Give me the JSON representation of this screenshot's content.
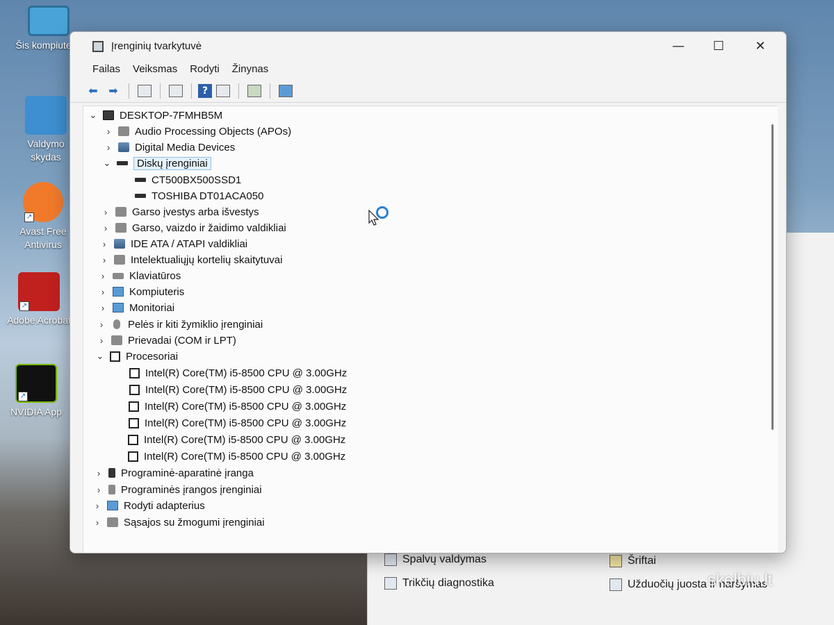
{
  "desktop_icons": [
    {
      "label": "Šis kompiuteris",
      "color": "#4aa3d8"
    },
    {
      "label": "Valdymo skydas",
      "color": "#3d8fd1"
    },
    {
      "label": "Avast Free Antivirus",
      "color": "#f07a2a"
    },
    {
      "label": "Adobe Acrobat",
      "color": "#c0201e"
    },
    {
      "label": "NVIDIA App",
      "color": "#76b900"
    }
  ],
  "window": {
    "title": "Įrenginių tvarkytuvė",
    "minimize": "—",
    "maximize": "☐",
    "close": "✕"
  },
  "menu": [
    "Failas",
    "Veiksmas",
    "Rodyti",
    "Žinynas"
  ],
  "toolbar": {
    "back": "⬅",
    "forward": "➡",
    "help": "?"
  },
  "tree": {
    "root": "DESKTOP-7FMHB5M",
    "items": [
      {
        "label": "Audio Processing Objects (APOs)",
        "expanded": false
      },
      {
        "label": "Digital Media Devices",
        "expanded": false
      },
      {
        "label": "Diskų įrenginiai",
        "expanded": true,
        "selected": true,
        "children": [
          "CT500BX500SSD1",
          "TOSHIBA DT01ACA050"
        ]
      },
      {
        "label": "Garso įvestys arba išvestys",
        "expanded": false
      },
      {
        "label": "Garso, vaizdo ir žaidimo valdikliai",
        "expanded": false
      },
      {
        "label": "IDE ATA / ATAPI valdikliai",
        "expanded": false
      },
      {
        "label": "Intelektualiųjų kortelių skaitytuvai",
        "expanded": false
      },
      {
        "label": "Klaviatūros",
        "expanded": false
      },
      {
        "label": "Kompiuteris",
        "expanded": false
      },
      {
        "label": "Monitoriai",
        "expanded": false
      },
      {
        "label": "Pelės ir kiti žymiklio įrenginiai",
        "expanded": false
      },
      {
        "label": "Prievadai (COM ir LPT)",
        "expanded": false
      },
      {
        "label": "Procesoriai",
        "expanded": true,
        "children": [
          "Intel(R) Core(TM) i5-8500 CPU @ 3.00GHz",
          "Intel(R) Core(TM) i5-8500 CPU @ 3.00GHz",
          "Intel(R) Core(TM) i5-8500 CPU @ 3.00GHz",
          "Intel(R) Core(TM) i5-8500 CPU @ 3.00GHz",
          "Intel(R) Core(TM) i5-8500 CPU @ 3.00GHz",
          "Intel(R) Core(TM) i5-8500 CPU @ 3.00GHz"
        ]
      },
      {
        "label": "Programinė-aparatinė įranga",
        "expanded": false
      },
      {
        "label": "Programinės įrangos įrenginiai",
        "expanded": false
      },
      {
        "label": "Rodyti adapterius",
        "expanded": false
      },
      {
        "label": "Sąsajos su žmogumi įrenginiai",
        "expanded": false
      }
    ]
  },
  "control_panel": {
    "items": [
      "Spalvų valdymas",
      "Šriftai",
      "Trikčių diagnostika",
      "Užduočių juosta ir naršymas"
    ]
  },
  "watermark": "skelbiu.lt"
}
